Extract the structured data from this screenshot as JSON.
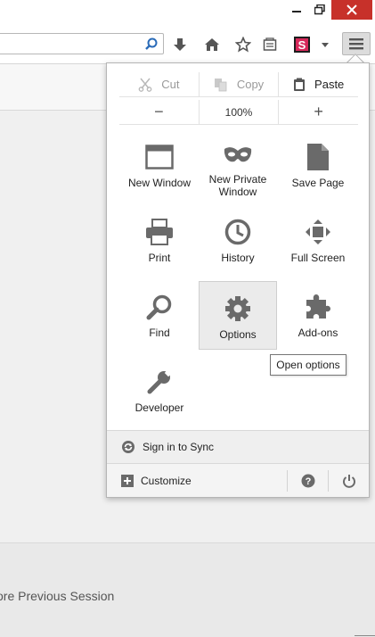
{
  "edit": {
    "cut_label": "Cut",
    "copy_label": "Copy",
    "paste_label": "Paste"
  },
  "zoom": {
    "minus": "−",
    "level": "100%",
    "plus": "+"
  },
  "menu_items": [
    {
      "label": "New Window",
      "icon": "new-window-icon"
    },
    {
      "label": "New Private Window",
      "icon": "private-mask-icon"
    },
    {
      "label": "Save Page",
      "icon": "save-page-icon"
    },
    {
      "label": "Print",
      "icon": "printer-icon"
    },
    {
      "label": "History",
      "icon": "history-clock-icon"
    },
    {
      "label": "Full Screen",
      "icon": "fullscreen-icon"
    },
    {
      "label": "Find",
      "icon": "magnifier-icon"
    },
    {
      "label": "Options",
      "icon": "gear-icon"
    },
    {
      "label": "Add-ons",
      "icon": "puzzle-icon"
    },
    {
      "label": "Developer",
      "icon": "wrench-icon"
    }
  ],
  "tooltip": "Open options",
  "sync_label": "Sign in to Sync",
  "customize_label": "Customize",
  "restore_session": "ore Previous Session",
  "colors": {
    "close_button": "#c7312a",
    "pocket_red": "#d7285a",
    "icon_gray": "#6a6a6a"
  }
}
